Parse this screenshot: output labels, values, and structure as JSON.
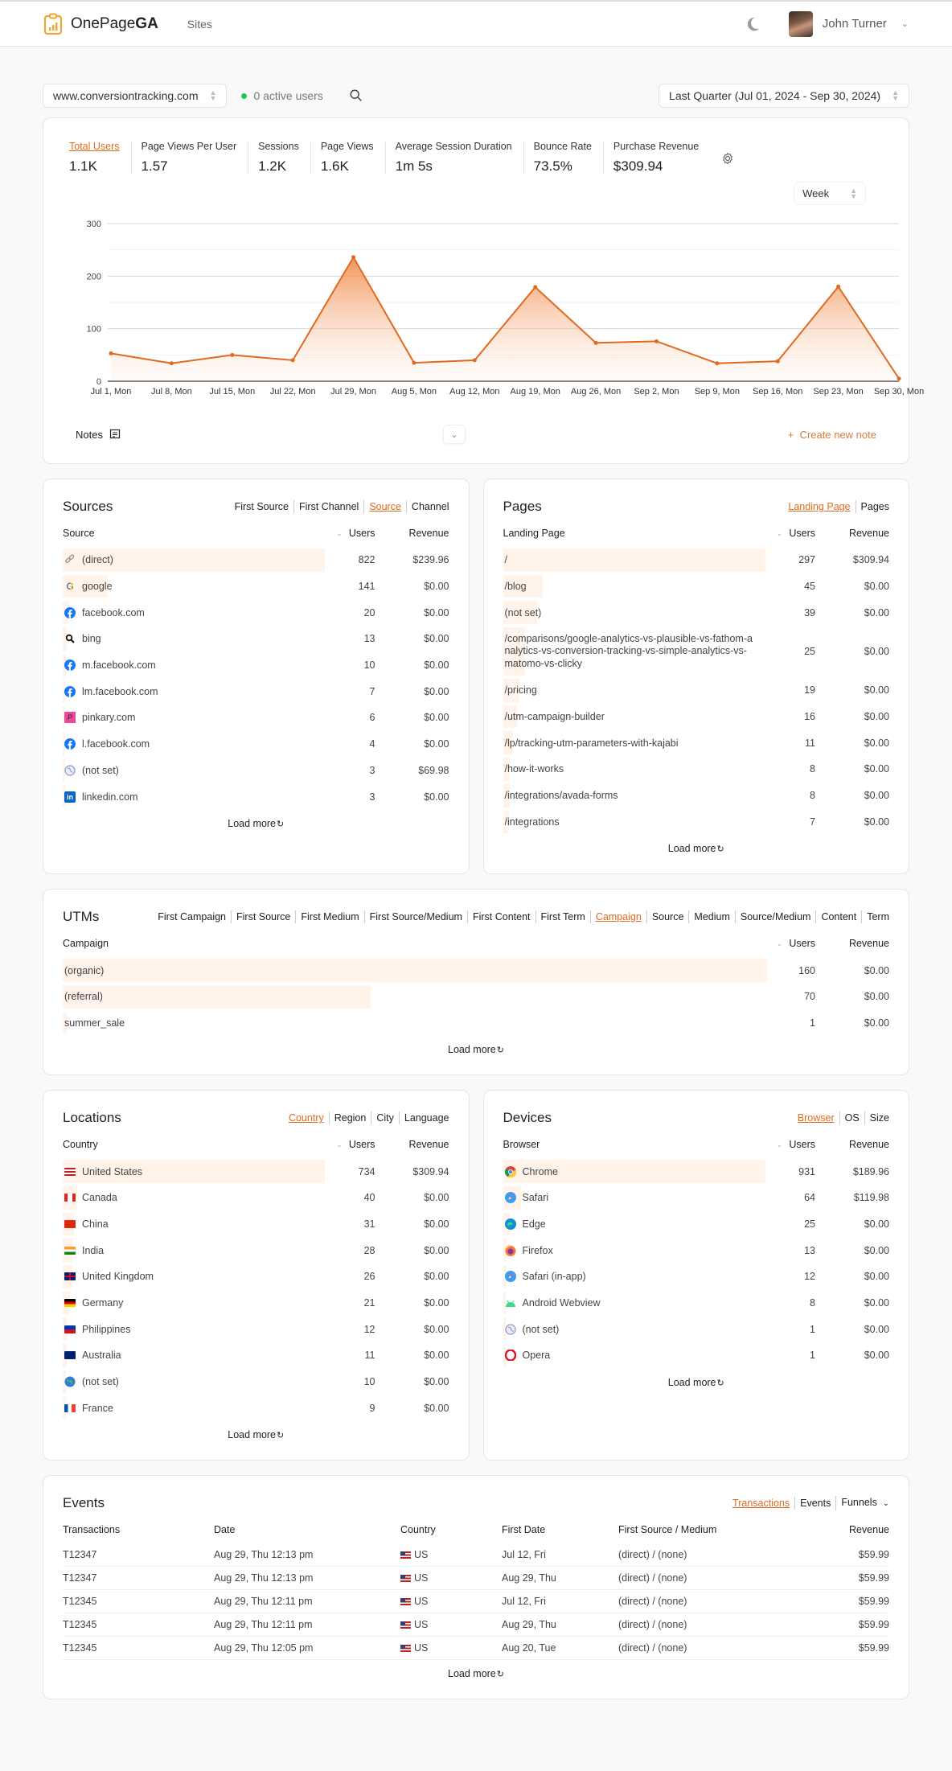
{
  "app": {
    "brand_prefix": "OnePage",
    "brand_suffix": "GA",
    "nav_sites": "Sites",
    "user_name": "John Turner"
  },
  "controls": {
    "site": "www.conversiontracking.com",
    "active_users": "0 active users",
    "date_range": "Last Quarter (Jul 01, 2024 - Sep 30, 2024)"
  },
  "metrics": [
    {
      "label": "Total Users",
      "value": "1.1K",
      "active": true
    },
    {
      "label": "Page Views Per User",
      "value": "1.57"
    },
    {
      "label": "Sessions",
      "value": "1.2K"
    },
    {
      "label": "Page Views",
      "value": "1.6K"
    },
    {
      "label": "Average Session Duration",
      "value": "1m 5s"
    },
    {
      "label": "Bounce Rate",
      "value": "73.5%"
    },
    {
      "label": "Purchase Revenue",
      "value": "$309.94"
    }
  ],
  "granularity": "Week",
  "chart_data": {
    "type": "area",
    "title": "Total Users",
    "x": [
      "Jul 1, Mon",
      "Jul 8, Mon",
      "Jul 15, Mon",
      "Jul 22, Mon",
      "Jul 29, Mon",
      "Aug 5, Mon",
      "Aug 12, Mon",
      "Aug 19, Mon",
      "Aug 26, Mon",
      "Sep 2, Mon",
      "Sep 9, Mon",
      "Sep 16, Mon",
      "Sep 23, Mon",
      "Sep 30, Mon"
    ],
    "series": [
      {
        "name": "Total Users",
        "values": [
          53,
          34,
          50,
          40,
          236,
          35,
          40,
          179,
          73,
          76,
          34,
          38,
          180,
          5
        ],
        "color": "#e06a1f"
      }
    ],
    "yticks": [
      0,
      100,
      200,
      300
    ],
    "ylim": [
      0,
      300
    ],
    "grid": true,
    "xlabel": "",
    "ylabel": ""
  },
  "notes": {
    "label": "Notes",
    "create": "Create new note"
  },
  "load_more": "Load more",
  "sources": {
    "title": "Sources",
    "tabs": [
      {
        "label": "First Source"
      },
      {
        "label": "First Channel"
      },
      {
        "label": "Source",
        "active": true
      },
      {
        "label": "Channel"
      }
    ],
    "columns": [
      "Source",
      "Users",
      "Revenue"
    ],
    "rows": [
      {
        "name": "(direct)",
        "icon": "link",
        "users": 822,
        "revenue": "$239.96"
      },
      {
        "name": "google",
        "icon": "google",
        "users": 141,
        "revenue": "$0.00"
      },
      {
        "name": "facebook.com",
        "icon": "facebook",
        "users": 20,
        "revenue": "$0.00"
      },
      {
        "name": "bing",
        "icon": "search",
        "users": 13,
        "revenue": "$0.00"
      },
      {
        "name": "m.facebook.com",
        "icon": "facebook",
        "users": 10,
        "revenue": "$0.00"
      },
      {
        "name": "lm.facebook.com",
        "icon": "facebook",
        "users": 7,
        "revenue": "$0.00"
      },
      {
        "name": "pinkary.com",
        "icon": "pinkary",
        "users": 6,
        "revenue": "$0.00"
      },
      {
        "name": "l.facebook.com",
        "icon": "facebook",
        "users": 4,
        "revenue": "$0.00"
      },
      {
        "name": "(not set)",
        "icon": "globe",
        "users": 3,
        "revenue": "$69.98"
      },
      {
        "name": "linkedin.com",
        "icon": "linkedin",
        "users": 3,
        "revenue": "$0.00"
      }
    ]
  },
  "pages": {
    "title": "Pages",
    "tabs": [
      {
        "label": "Landing Page",
        "active": true
      },
      {
        "label": "Pages"
      }
    ],
    "columns": [
      "Landing Page",
      "Users",
      "Revenue"
    ],
    "rows": [
      {
        "name": "/",
        "users": 297,
        "revenue": "$309.94"
      },
      {
        "name": "/blog",
        "users": 45,
        "revenue": "$0.00"
      },
      {
        "name": "(not set)",
        "users": 39,
        "revenue": "$0.00"
      },
      {
        "name": "/comparisons/google-analytics-vs-plausible-vs-fathom-analytics-vs-conversion-tracking-vs-simple-analytics-vs-matomo-vs-clicky",
        "users": 25,
        "revenue": "$0.00",
        "tall": true
      },
      {
        "name": "/pricing",
        "users": 19,
        "revenue": "$0.00"
      },
      {
        "name": "/utm-campaign-builder",
        "users": 16,
        "revenue": "$0.00"
      },
      {
        "name": "/lp/tracking-utm-parameters-with-kajabi",
        "users": 11,
        "revenue": "$0.00"
      },
      {
        "name": "/how-it-works",
        "users": 8,
        "revenue": "$0.00"
      },
      {
        "name": "/integrations/avada-forms",
        "users": 8,
        "revenue": "$0.00"
      },
      {
        "name": "/integrations",
        "users": 7,
        "revenue": "$0.00"
      }
    ]
  },
  "utms": {
    "title": "UTMs",
    "tabs": [
      {
        "label": "First Campaign"
      },
      {
        "label": "First Source"
      },
      {
        "label": "First Medium"
      },
      {
        "label": "First Source/Medium"
      },
      {
        "label": "First Content"
      },
      {
        "label": "First Term"
      },
      {
        "label": "Campaign",
        "active": true
      },
      {
        "label": "Source"
      },
      {
        "label": "Medium"
      },
      {
        "label": "Source/Medium"
      },
      {
        "label": "Content"
      },
      {
        "label": "Term"
      }
    ],
    "columns": [
      "Campaign",
      "Users",
      "Revenue"
    ],
    "rows": [
      {
        "name": "(organic)",
        "users": 160,
        "revenue": "$0.00"
      },
      {
        "name": "(referral)",
        "users": 70,
        "revenue": "$0.00"
      },
      {
        "name": "summer_sale",
        "users": 1,
        "revenue": "$0.00"
      }
    ]
  },
  "locations": {
    "title": "Locations",
    "tabs": [
      {
        "label": "Country",
        "active": true
      },
      {
        "label": "Region"
      },
      {
        "label": "City"
      },
      {
        "label": "Language"
      }
    ],
    "columns": [
      "Country",
      "Users",
      "Revenue"
    ],
    "rows": [
      {
        "name": "United States",
        "flag": "us",
        "users": 734,
        "revenue": "$309.94"
      },
      {
        "name": "Canada",
        "flag": "ca",
        "users": 40,
        "revenue": "$0.00"
      },
      {
        "name": "China",
        "flag": "cn",
        "users": 31,
        "revenue": "$0.00"
      },
      {
        "name": "India",
        "flag": "in",
        "users": 28,
        "revenue": "$0.00"
      },
      {
        "name": "United Kingdom",
        "flag": "gb",
        "users": 26,
        "revenue": "$0.00"
      },
      {
        "name": "Germany",
        "flag": "de",
        "users": 21,
        "revenue": "$0.00"
      },
      {
        "name": "Philippines",
        "flag": "ph",
        "users": 12,
        "revenue": "$0.00"
      },
      {
        "name": "Australia",
        "flag": "au",
        "users": 11,
        "revenue": "$0.00"
      },
      {
        "name": "(not set)",
        "flag": "globe",
        "users": 10,
        "revenue": "$0.00"
      },
      {
        "name": "France",
        "flag": "fr",
        "users": 9,
        "revenue": "$0.00"
      }
    ]
  },
  "devices": {
    "title": "Devices",
    "tabs": [
      {
        "label": "Browser",
        "active": true
      },
      {
        "label": "OS"
      },
      {
        "label": "Size"
      }
    ],
    "columns": [
      "Browser",
      "Users",
      "Revenue"
    ],
    "rows": [
      {
        "name": "Chrome",
        "icon": "chrome",
        "users": 931,
        "revenue": "$189.96"
      },
      {
        "name": "Safari",
        "icon": "safari",
        "users": 64,
        "revenue": "$119.98"
      },
      {
        "name": "Edge",
        "icon": "edge",
        "users": 25,
        "revenue": "$0.00"
      },
      {
        "name": "Firefox",
        "icon": "firefox",
        "users": 13,
        "revenue": "$0.00"
      },
      {
        "name": "Safari (in-app)",
        "icon": "safari",
        "users": 12,
        "revenue": "$0.00"
      },
      {
        "name": "Android Webview",
        "icon": "android",
        "users": 8,
        "revenue": "$0.00"
      },
      {
        "name": "(not set)",
        "icon": "globe",
        "users": 1,
        "revenue": "$0.00"
      },
      {
        "name": "Opera",
        "icon": "opera",
        "users": 1,
        "revenue": "$0.00"
      }
    ]
  },
  "events": {
    "title": "Events",
    "tabs": [
      {
        "label": "Transactions",
        "active": true
      },
      {
        "label": "Events"
      },
      {
        "label": "Funnels",
        "dropdown": true
      }
    ],
    "columns": [
      "Transactions",
      "Date",
      "Country",
      "First Date",
      "First Source / Medium",
      "Revenue"
    ],
    "rows": [
      {
        "id": "T12347",
        "date": "Aug 29, Thu 12:13 pm",
        "country": "US",
        "first_date": "Jul 12, Fri",
        "source_medium": "(direct) / (none)",
        "revenue": "$59.99"
      },
      {
        "id": "T12347",
        "date": "Aug 29, Thu 12:13 pm",
        "country": "US",
        "first_date": "Aug 29, Thu",
        "source_medium": "(direct) / (none)",
        "revenue": "$59.99"
      },
      {
        "id": "T12345",
        "date": "Aug 29, Thu 12:11 pm",
        "country": "US",
        "first_date": "Jul 12, Fri",
        "source_medium": "(direct) / (none)",
        "revenue": "$59.99"
      },
      {
        "id": "T12345",
        "date": "Aug 29, Thu 12:11 pm",
        "country": "US",
        "first_date": "Aug 29, Thu",
        "source_medium": "(direct) / (none)",
        "revenue": "$59.99"
      },
      {
        "id": "T12345",
        "date": "Aug 29, Thu 12:05 pm",
        "country": "US",
        "first_date": "Aug 20, Tue",
        "source_medium": "(direct) / (none)",
        "revenue": "$59.99"
      }
    ]
  },
  "colors": {
    "accent": "#e06a1f",
    "bar_fill": "#fff3ea",
    "active_dot": "#22c55e"
  }
}
